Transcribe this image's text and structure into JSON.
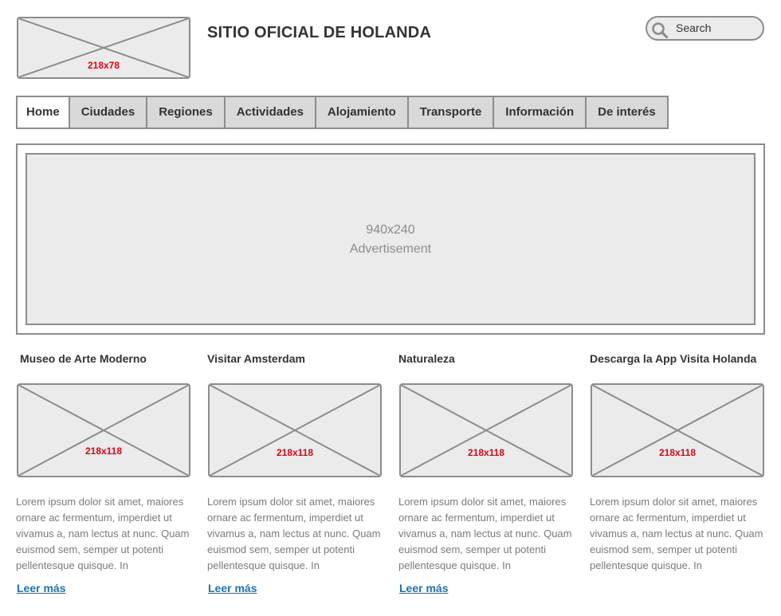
{
  "header": {
    "logo_label": "218x78",
    "title": "SITIO OFICIAL DE HOLANDA",
    "search_placeholder": "Search"
  },
  "nav": {
    "tabs": [
      {
        "label": "Home"
      },
      {
        "label": "Ciudades"
      },
      {
        "label": "Regiones"
      },
      {
        "label": "Actividades"
      },
      {
        "label": "Alojamiento"
      },
      {
        "label": "Transporte"
      },
      {
        "label": "Información"
      },
      {
        "label": "De interés"
      }
    ]
  },
  "ad": {
    "size": "940x240",
    "label": "Advertisement"
  },
  "cards": [
    {
      "title": "Museo de Arte Moderno",
      "image_label": "218x118",
      "body": "Lorem ipsum dolor sit amet, maiores ornare ac fermentum, imperdiet ut vivamus a, nam lectus at nunc. Quam euismod sem, semper ut potenti pellentesque quisque. In",
      "link": "Leer más"
    },
    {
      "title": "Visitar Amsterdam",
      "image_label": "218x118",
      "body": "Lorem ipsum dolor sit amet, maiores ornare ac fermentum, imperdiet ut vivamus a, nam lectus at nunc. Quam euismod sem, semper ut potenti pellentesque quisque. In",
      "link": "Leer más"
    },
    {
      "title": "Naturaleza",
      "image_label": "218x118",
      "body": "Lorem ipsum dolor sit amet, maiores ornare ac fermentum, imperdiet ut vivamus a, nam lectus at nunc. Quam euismod sem, semper ut potenti pellentesque quisque. In",
      "link": "Leer más"
    },
    {
      "title": "Descarga la App Visita Holanda",
      "image_label": "218x118",
      "body": "Lorem ipsum dolor sit amet, maiores ornare ac fermentum, imperdiet ut vivamus a, nam lectus at nunc. Quam euismod sem, semper ut potenti pellentesque quisque. In",
      "link": ""
    }
  ],
  "colors": {
    "placeholder_fill": "#ebebeb",
    "border": "#8c8c8c",
    "dimension_text": "#e0001b",
    "link": "#1a73b7",
    "body_text": "#7a7a7a"
  },
  "icons": {
    "search": "search-icon"
  }
}
